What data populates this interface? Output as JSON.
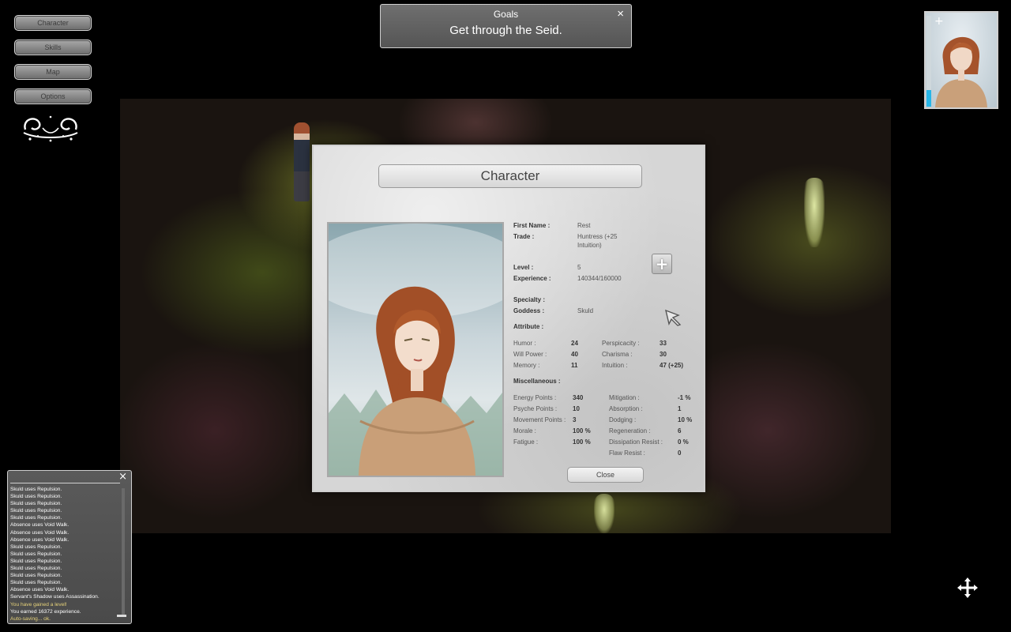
{
  "menu": [
    {
      "id": "character",
      "label": "Character"
    },
    {
      "id": "skills",
      "label": "Skills"
    },
    {
      "id": "map",
      "label": "Map"
    },
    {
      "id": "options",
      "label": "Options"
    }
  ],
  "goals": {
    "title": "Goals",
    "text": "Get through the Seid.",
    "close": "×"
  },
  "portrait_thumb": {
    "plus": "+",
    "experience_fill": 0.18
  },
  "character": {
    "title": "Character",
    "first_name": {
      "label": "First Name :",
      "value": "Rest"
    },
    "trade": {
      "label": "Trade :",
      "value_line1": "Huntress (+25",
      "value_line2": "Intuition)"
    },
    "level": {
      "label": "Level :",
      "value": "5"
    },
    "experience": {
      "label": "Experience :",
      "value": "140344/160000"
    },
    "specialty": {
      "label": "Specialty :"
    },
    "goddess": {
      "label": "Goddess :",
      "value": "Skuld"
    },
    "attribute_header": "Attribute :",
    "attributes_left": [
      {
        "label": "Humor :",
        "value": "24"
      },
      {
        "label": "Will Power :",
        "value": "40"
      },
      {
        "label": "Memory :",
        "value": "11"
      }
    ],
    "attributes_right": [
      {
        "label": "Perspicacity :",
        "value": "33"
      },
      {
        "label": "Charisma :",
        "value": "30"
      },
      {
        "label": "Intuition :",
        "value": "47 (+25)"
      }
    ],
    "misc_header": "Miscellaneous :",
    "misc_left": [
      {
        "label": "Energy Points :",
        "value": "340"
      },
      {
        "label": "Psyche Points :",
        "value": "10"
      },
      {
        "label": "Movement Points :",
        "value": "3"
      },
      {
        "label": "Morale :",
        "value": "100 %"
      },
      {
        "label": "Fatigue :",
        "value": "100 %"
      }
    ],
    "misc_right": [
      {
        "label": "Mitigation :",
        "value": "-1 %"
      },
      {
        "label": "Absorption :",
        "value": "1"
      },
      {
        "label": "Dodging :",
        "value": "10 %"
      },
      {
        "label": "Regeneration :",
        "value": "6"
      },
      {
        "label": "Dissipation Resist :",
        "value": "0 %"
      },
      {
        "label": "Flaw Resist :",
        "value": "0"
      }
    ],
    "level_up_symbol": "+",
    "close_label": "Close"
  },
  "log": {
    "close": "×",
    "lines": [
      {
        "text": "Skuld uses Repulsion.",
        "hl": false
      },
      {
        "text": "Skuld uses Repulsion.",
        "hl": false
      },
      {
        "text": "Skuld uses Repulsion.",
        "hl": false
      },
      {
        "text": "Skuld uses Repulsion.",
        "hl": false
      },
      {
        "text": "Skuld uses Repulsion.",
        "hl": false
      },
      {
        "text": "Absence uses Void Walk.",
        "hl": false
      },
      {
        "text": "Absence uses Void Walk.",
        "hl": false
      },
      {
        "text": "Absence uses Void Walk.",
        "hl": false
      },
      {
        "text": "Skuld uses Repulsion.",
        "hl": false
      },
      {
        "text": "Skuld uses Repulsion.",
        "hl": false
      },
      {
        "text": "Skuld uses Repulsion.",
        "hl": false
      },
      {
        "text": "Skuld uses Repulsion.",
        "hl": false
      },
      {
        "text": "Skuld uses Repulsion.",
        "hl": false
      },
      {
        "text": "Skuld uses Repulsion.",
        "hl": false
      },
      {
        "text": "Absence uses Void Walk.",
        "hl": false
      },
      {
        "text": "Servant's Shadow uses Assassination.",
        "hl": false
      },
      {
        "text": "You have gained a level!",
        "hl": true
      },
      {
        "text": "You earned 16372 experience.",
        "hl": false
      },
      {
        "text": "Auto-saving... ok.",
        "hl": true
      }
    ]
  },
  "icons": {
    "ornament": "ornament-icon",
    "goddess": "arrow-cursor-icon",
    "move": "move-arrows-icon",
    "level_up": "plus-icon"
  }
}
